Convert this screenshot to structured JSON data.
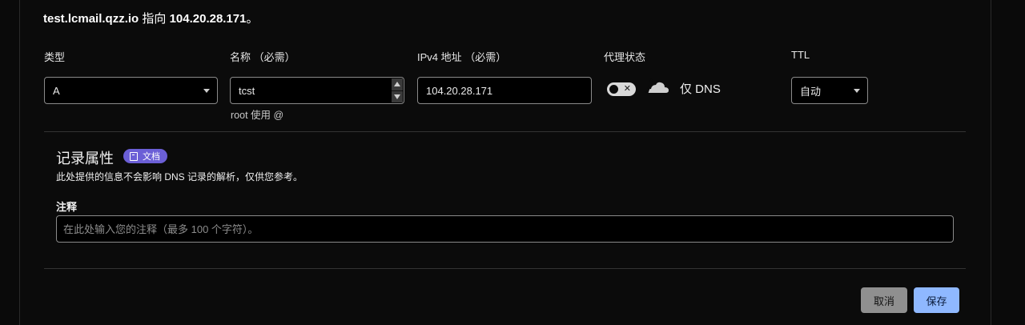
{
  "heading": {
    "hostname": "test.lcmail.qzz.io",
    "points_to": "指向",
    "ip": "104.20.28.171",
    "period": "。"
  },
  "fields": {
    "type": {
      "label": "类型",
      "value": "A"
    },
    "name": {
      "label": "名称 （必需）",
      "value": "tcst",
      "hint": "root 使用 @"
    },
    "ipv4": {
      "label": "IPv4 地址 （必需）",
      "value": "104.20.28.171"
    },
    "proxy": {
      "label": "代理状态",
      "toggle_state": "off",
      "toggle_mark": "✕",
      "icon": "cloud-icon",
      "text": "仅 DNS"
    },
    "ttl": {
      "label": "TTL",
      "value": "自动"
    }
  },
  "record_attributes": {
    "title": "记录属性",
    "badge_label": "文档",
    "badge_icon": "doc-icon",
    "badge_color": "#6b5fd6",
    "description": "此处提供的信息不会影响 DNS 记录的解析，仅供您参考。",
    "comment": {
      "label": "注释",
      "placeholder": "在此处输入您的注释（最多 100 个字符）。",
      "value": ""
    }
  },
  "actions": {
    "cancel_label": "取消",
    "save_label": "保存",
    "save_color": "#8fb8ff",
    "cancel_color": "#8f8f8f"
  }
}
